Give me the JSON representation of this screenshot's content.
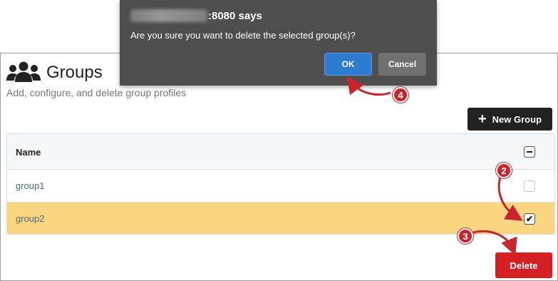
{
  "page": {
    "title": "Groups",
    "subtitle": "Add, configure, and delete group profiles",
    "new_group_label": "New Group",
    "delete_label": "Delete"
  },
  "table": {
    "header_name": "Name",
    "rows": [
      {
        "name": "group1",
        "checked": false
      },
      {
        "name": "group2",
        "checked": true
      }
    ]
  },
  "dialog": {
    "origin_suffix": ":8080 says",
    "message": "Are you sure you want to delete the selected group(s)?",
    "ok_label": "OK",
    "cancel_label": "Cancel"
  },
  "callouts": [
    "2",
    "3",
    "4"
  ],
  "icons": {
    "groups": "users-icon",
    "new_group": "plus-icon",
    "checkmark": "checkmark-icon"
  },
  "colors": {
    "accent_blue": "#2e7bd2",
    "danger_red": "#d42020",
    "selected_row": "#fbd681",
    "dialog_bg": "#4e4e4e",
    "callout_red": "#c8262c"
  }
}
